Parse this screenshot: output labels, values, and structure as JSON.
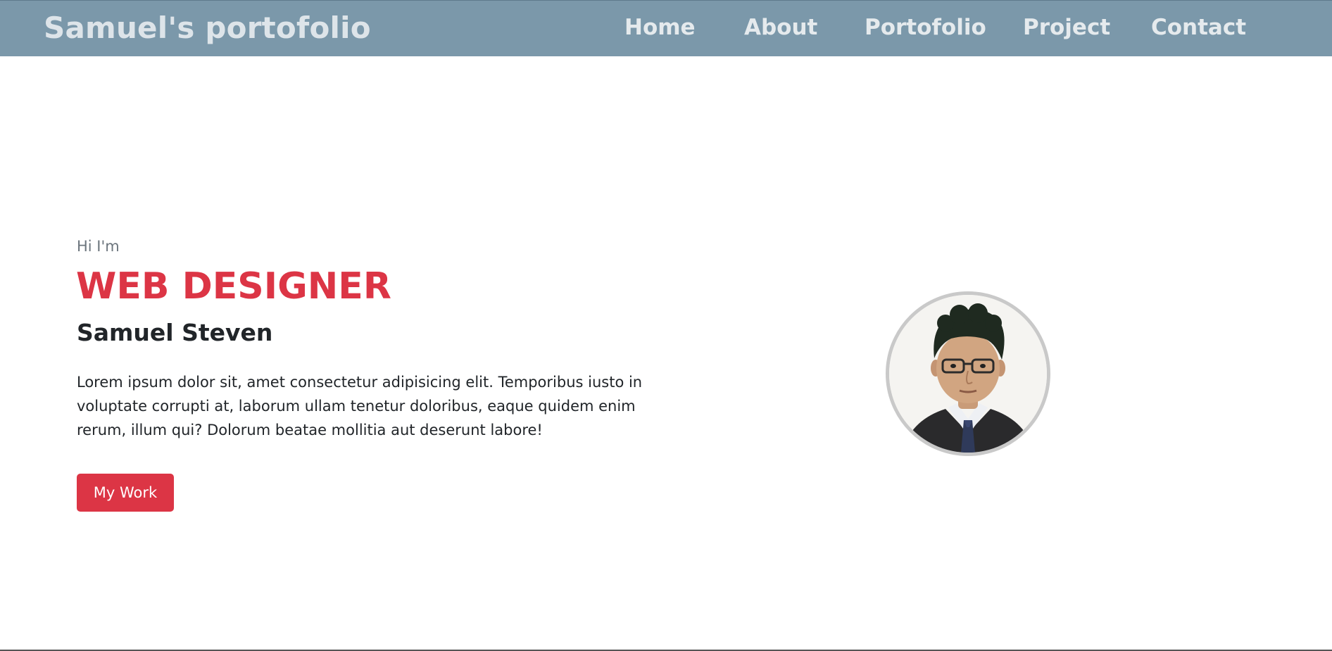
{
  "navbar": {
    "brand": "Samuel's portofolio",
    "links": [
      {
        "label": "Home"
      },
      {
        "label": "About"
      },
      {
        "label": "Portofolio"
      },
      {
        "label": "Project"
      },
      {
        "label": "Contact"
      }
    ]
  },
  "hero": {
    "intro": "Hi I'm",
    "headline": "WEB DESIGNER",
    "name": "Samuel Steven",
    "bio": "Lorem ipsum dolor sit, amet consectetur adipisicing elit. Temporibus iusto in voluptate corrupti at, laborum ullam tenetur doloribus, eaque quidem enim rerum, illum qui? Dolorum beatae mollitia aut deserunt labore!",
    "cta_label": "My Work"
  },
  "colors": {
    "navbar_bg": "#7b98aa",
    "accent": "#dc3545",
    "text_dark": "#212529",
    "text_muted": "#6c757d"
  }
}
